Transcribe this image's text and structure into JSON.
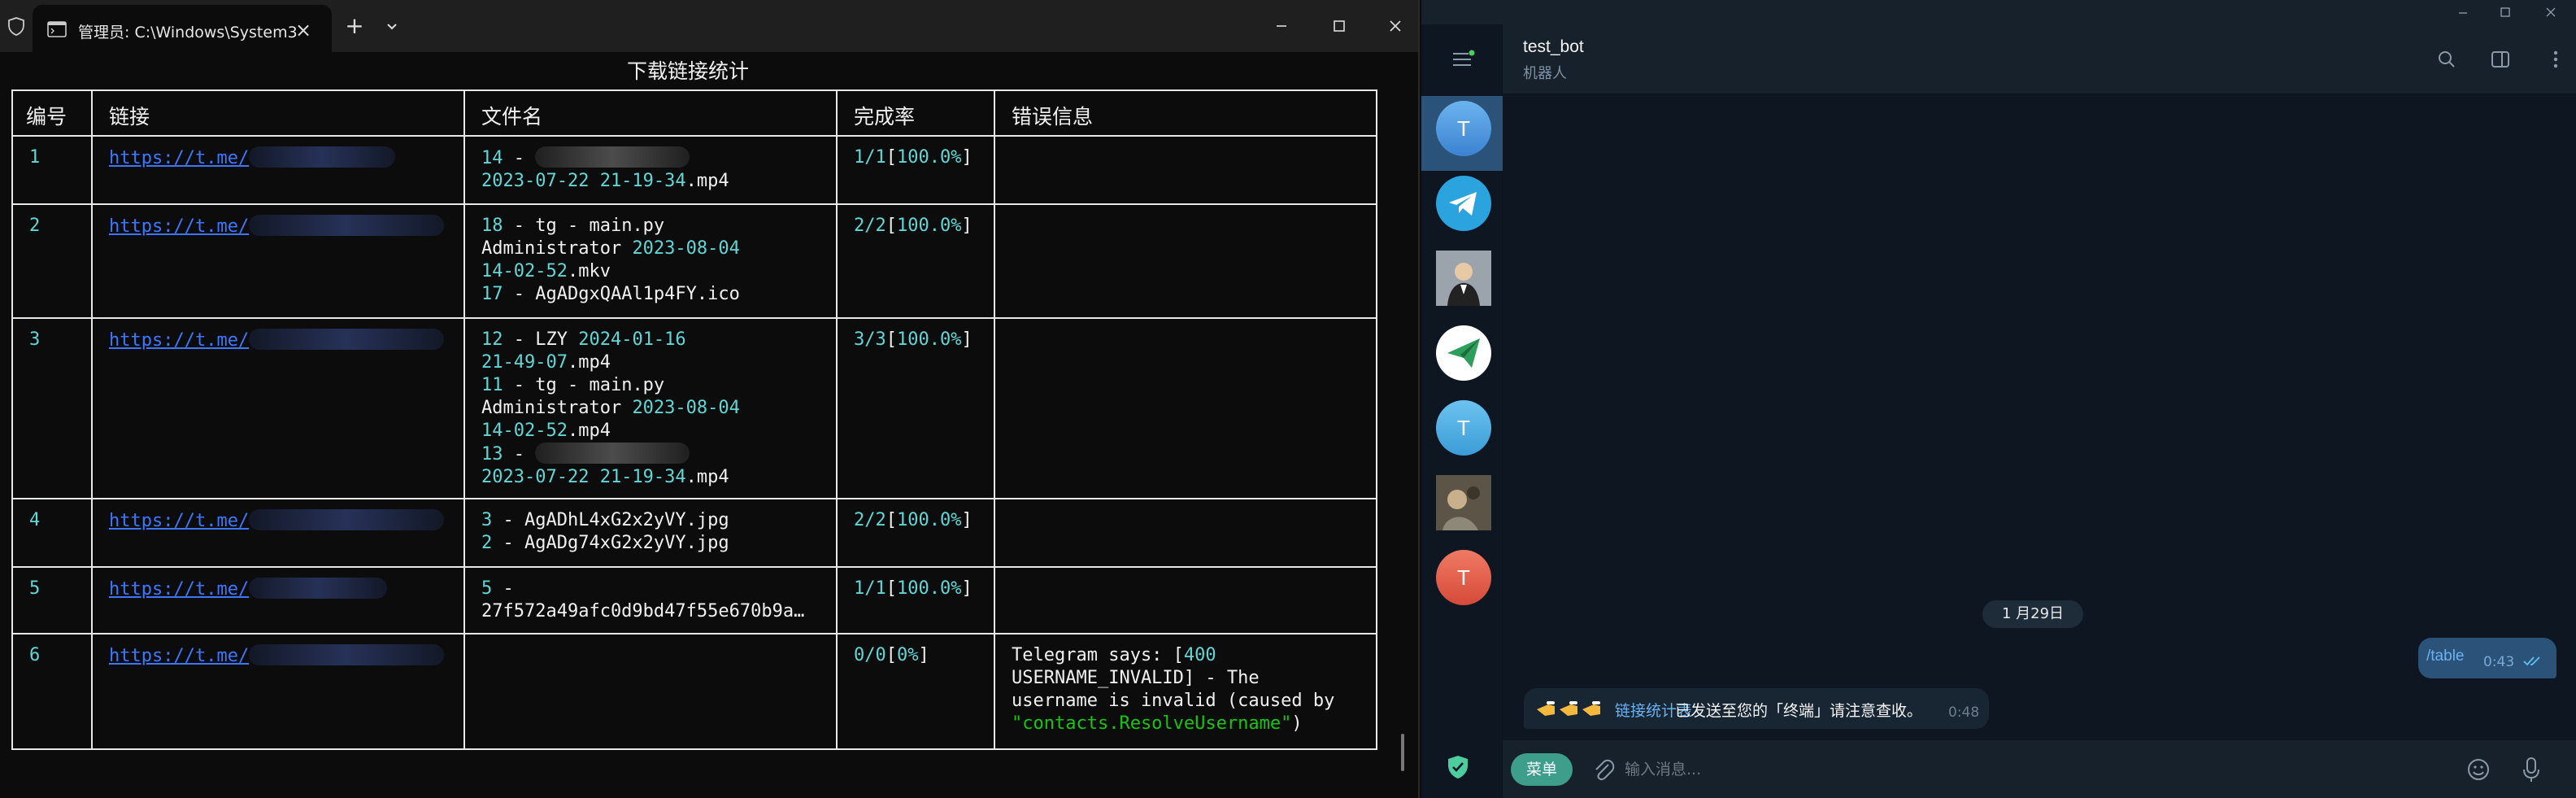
{
  "terminal": {
    "tab_title": "管理员: C:\\Windows\\System3:",
    "table_title": "下载链接统计",
    "headers": {
      "index": "编号",
      "link": "链接",
      "filename": "文件名",
      "rate": "完成率",
      "error": "错误信息"
    },
    "rows": [
      {
        "index": "1",
        "link": "https://t.me/",
        "files": [
          {
            "num": "14",
            "mid": " - ",
            "rest": ""
          },
          {
            "num": "2023-07-22 21-19-34",
            "mid": ".mp4",
            "rest": ""
          }
        ],
        "rate": "1/1",
        "pct": "100.0%",
        "error": []
      },
      {
        "index": "2",
        "link": "https://t.me/",
        "files": [
          {
            "num": "18",
            "mid": " - tg - main.py",
            "rest": ""
          },
          {
            "num": "",
            "mid": "Administrator ",
            "rest": "2023-08-04"
          },
          {
            "num": "14-02-52",
            "mid": ".mkv",
            "rest": ""
          },
          {
            "num": "17",
            "mid": " - AgADgxQAAl1p4FY.ico",
            "rest": ""
          }
        ],
        "rate": "2/2",
        "pct": "100.0%",
        "error": []
      },
      {
        "index": "3",
        "link": "https://t.me/",
        "files": [
          {
            "num": "12",
            "mid": " - LZY ",
            "rest": "2024-01-16"
          },
          {
            "num": "21-49-07",
            "mid": ".mp4",
            "rest": ""
          },
          {
            "num": "11",
            "mid": " - tg - main.py",
            "rest": ""
          },
          {
            "num": "",
            "mid": "Administrator ",
            "rest": "2023-08-04"
          },
          {
            "num": "14-02-52",
            "mid": ".mp4",
            "rest": ""
          },
          {
            "num": "13",
            "mid": " - ",
            "rest": ""
          },
          {
            "num": "2023-07-22 21-19-34",
            "mid": ".mp4",
            "rest": ""
          }
        ],
        "rate": "3/3",
        "pct": "100.0%",
        "error": []
      },
      {
        "index": "4",
        "link": "https://t.me/",
        "files": [
          {
            "num": "3",
            "mid": " - AgADhL4xG2x2yVY.jpg",
            "rest": ""
          },
          {
            "num": "2",
            "mid": " - AgADg74xG2x2yVY.jpg",
            "rest": ""
          }
        ],
        "rate": "2/2",
        "pct": "100.0%",
        "error": []
      },
      {
        "index": "5",
        "link": "https://t.me/",
        "files": [
          {
            "num": "5",
            "mid": " -",
            "rest": ""
          },
          {
            "num": "",
            "mid": "27f572a49afc0d9bd47f55e670b9a…",
            "rest": ""
          }
        ],
        "rate": "1/1",
        "pct": "100.0%",
        "error": []
      },
      {
        "index": "6",
        "link": "https://t.me/",
        "files": [],
        "rate": "0/0",
        "pct": "0%",
        "error": [
          "Telegram says: [",
          "400",
          "USERNAME_INVALID] - The",
          "username is invalid (caused by",
          "\"contacts.ResolveUsername\"",
          ")"
        ]
      }
    ]
  },
  "telegram": {
    "chat_name": "test_bot",
    "chat_status": "机器人",
    "avatars": [
      {
        "letter": "T",
        "color": "#4a90d9"
      },
      {
        "letter": "",
        "color": "#2aa3df"
      },
      {
        "letter": "",
        "color": "#8a8a8a"
      },
      {
        "letter": "",
        "color": "#ffffff"
      },
      {
        "letter": "T",
        "color": "#4aa3d8"
      },
      {
        "letter": "",
        "color": "#6b5d4a"
      },
      {
        "letter": "T",
        "color": "#e05a4a"
      }
    ],
    "date_pill": "1 月29日",
    "out_message": {
      "text": "/table",
      "time": "0:43"
    },
    "in_message": {
      "link": "链接统计表",
      "text": "已发送至您的「终端」请注意查收。",
      "time": "0:48"
    },
    "composer": {
      "menu_label": "菜单",
      "placeholder": "输入消息..."
    }
  }
}
